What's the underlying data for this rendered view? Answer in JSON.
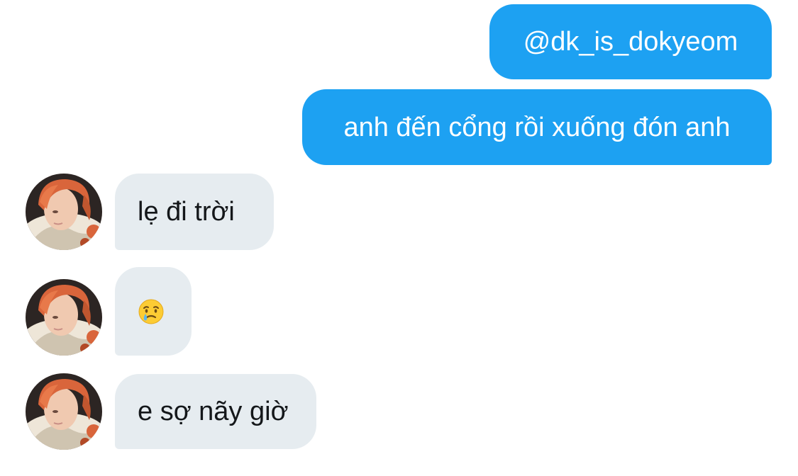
{
  "conversation": {
    "sent_messages": [
      {
        "text": "@dk_is_dokyeom"
      },
      {
        "text": "anh đến cổng rồi xuống đón anh"
      }
    ],
    "received_messages": [
      {
        "text": "lẹ đi trời"
      },
      {
        "text": "🥲",
        "emoji_icon": "smiling-face-with-tear-icon"
      },
      {
        "text": "e sợ nãy giờ"
      }
    ],
    "avatar_icon": "profile-photo-avatar"
  },
  "colors": {
    "sent_bubble": "#1da1f2",
    "received_bubble": "#e6ecf0",
    "sent_text": "#ffffff",
    "received_text": "#14171a"
  }
}
